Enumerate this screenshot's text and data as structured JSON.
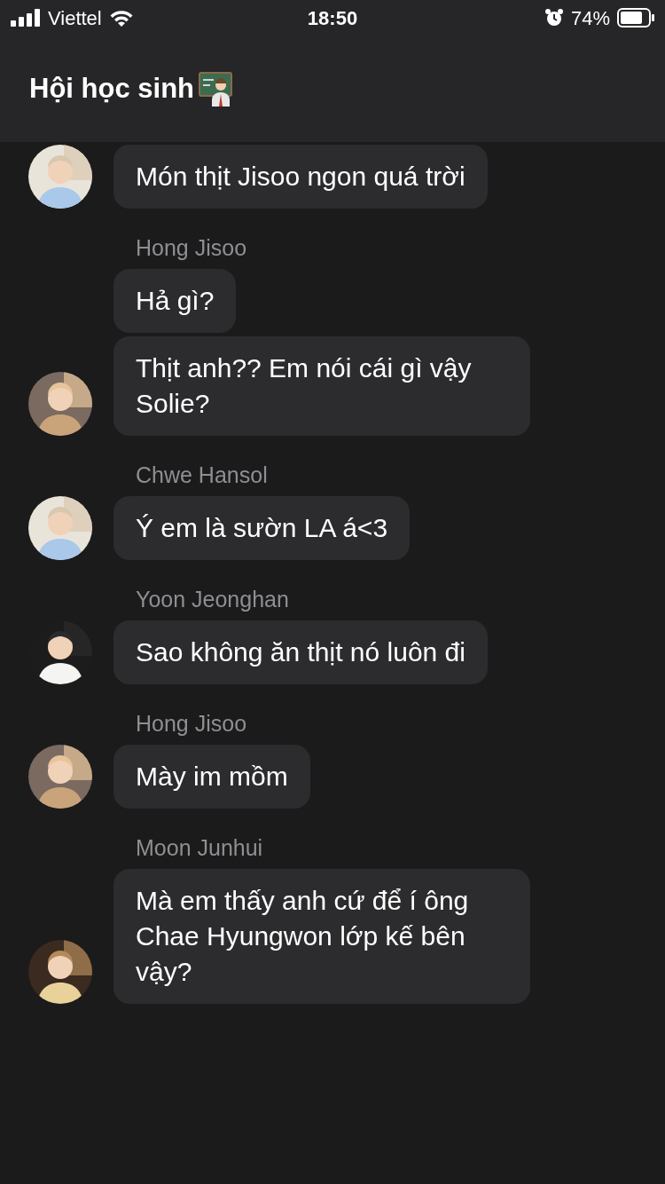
{
  "status_bar": {
    "carrier": "Viettel",
    "time": "18:50",
    "battery": "74%"
  },
  "header": {
    "title": "Hội học sinh"
  },
  "groups": [
    {
      "messages": [
        "Món thịt Jisoo ngon quá trời"
      ]
    },
    {
      "sender": "Hong Jisoo",
      "messages": [
        "Hả gì?",
        "Thịt anh?? Em nói cái gì vậy Solie?"
      ]
    },
    {
      "sender": "Chwe Hansol",
      "messages": [
        "Ý em là sườn LA á<3"
      ]
    },
    {
      "sender": "Yoon Jeonghan",
      "messages": [
        "Sao không ăn thịt nó luôn đi"
      ]
    },
    {
      "sender": "Hong Jisoo",
      "messages": [
        "Mày im mồm"
      ]
    },
    {
      "sender": "Moon Junhui",
      "messages": [
        "Mà em thấy anh cứ để í ông Chae Hyungwon lớp kế bên vậy?"
      ]
    }
  ]
}
